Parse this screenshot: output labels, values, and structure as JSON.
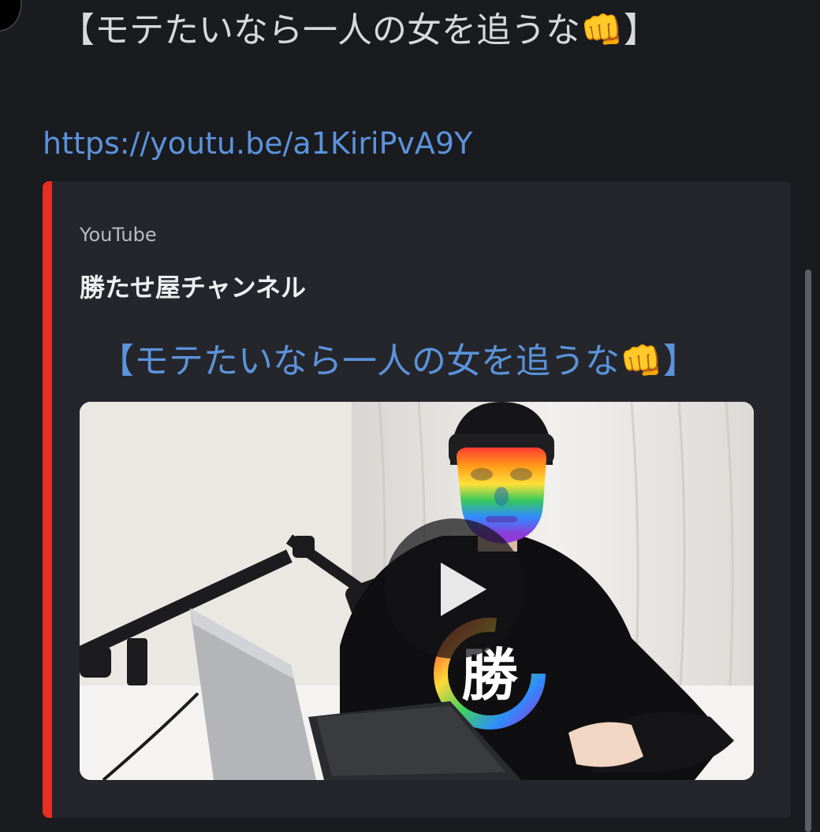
{
  "message": {
    "title": "【モテたいなら一人の女を追うな👊】",
    "link": "https://youtu.be/a1KiriPvA9Y"
  },
  "embed": {
    "provider": "YouTube",
    "author": "勝たせ屋チャンネル",
    "title": "【モテたいなら一人の女を追うな👊】",
    "accent_color": "#e62e22",
    "thumbnail": {
      "shirt_text": "勝",
      "play_icon": "play-icon"
    }
  },
  "colors": {
    "background": "#1a1b1e",
    "embed_background": "#25262b",
    "link": "#5b93dc",
    "text": "#d8d9dc"
  }
}
